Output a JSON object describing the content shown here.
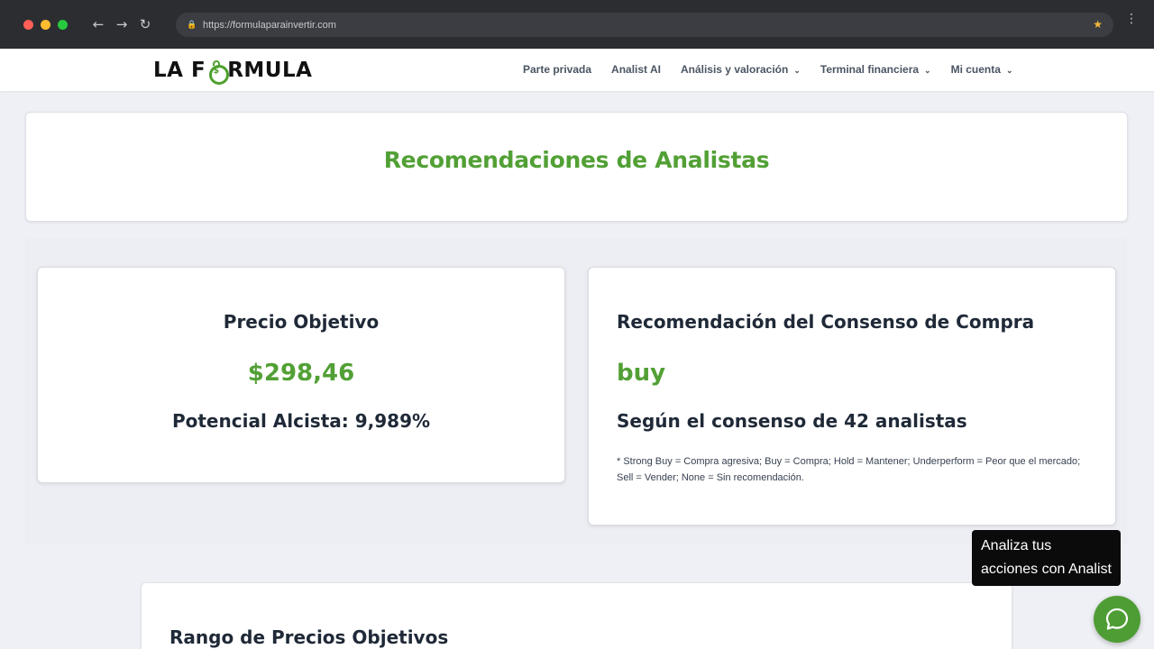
{
  "browser": {
    "url": "https://formulaparainvertir.com",
    "back_icon": "arrow-left",
    "forward_icon": "arrow-right",
    "reload_icon": "reload",
    "bookmark_icon": "star",
    "menu_icon": "kebab"
  },
  "header": {
    "logo_text_left": "LA F",
    "logo_text_right": "RMULA",
    "nav": [
      {
        "label": "Parte privada",
        "dropdown": false
      },
      {
        "label": "Analist AI",
        "dropdown": false
      },
      {
        "label": "Análisis y valoración",
        "dropdown": true
      },
      {
        "label": "Terminal financiera",
        "dropdown": true
      },
      {
        "label": "Mi cuenta",
        "dropdown": true
      }
    ]
  },
  "page": {
    "title": "Recomendaciones de Analistas"
  },
  "price_target": {
    "heading": "Precio Objetivo",
    "value": "$298,46",
    "upside": "Potencial Alcista: 9,989%"
  },
  "consensus": {
    "heading": "Recomendación del Consenso de Compra",
    "recommendation": "buy",
    "analysts": "Según el consenso de 42 analistas",
    "note": "* Strong Buy = Compra agresiva; Buy = Compra; Hold = Mantener; Underperform = Peor que el mercado; Sell = Vender; None = Sin recomendación."
  },
  "range": {
    "heading": "Rango de Precios Objetivos"
  },
  "chat": {
    "tooltip": "Analiza tus acciones con Analist AI",
    "icon": "chat-bubble-icon"
  },
  "colors": {
    "accent": "#52a035",
    "heading": "#1f2937"
  }
}
